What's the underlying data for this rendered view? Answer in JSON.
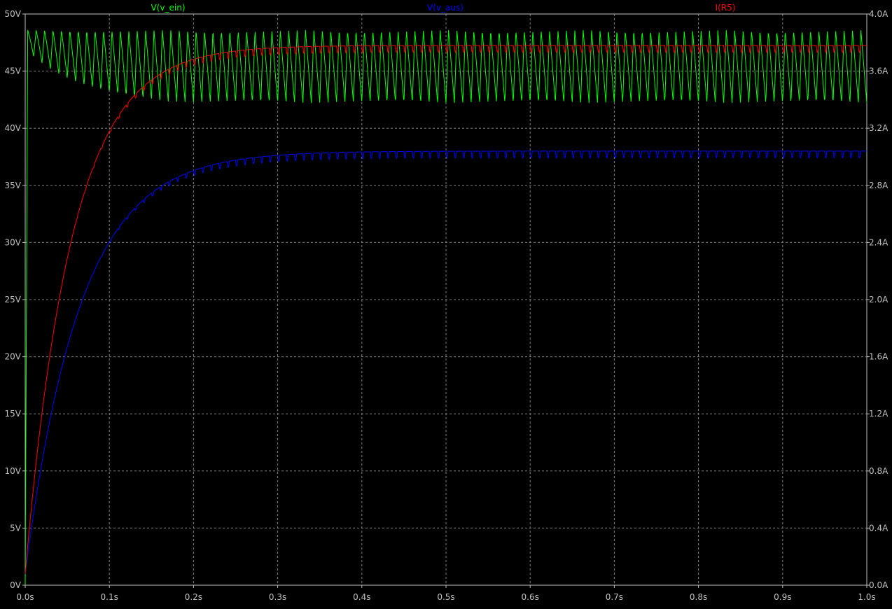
{
  "chart_data": {
    "type": "line",
    "xlabel": "",
    "ylabel_left": "",
    "ylabel_right": "",
    "xlim": [
      0,
      1.0
    ],
    "ylim_left": [
      0,
      50
    ],
    "ylim_right": [
      0,
      4.0
    ],
    "grid": true,
    "legend_placement": "top",
    "x_ticks": [
      "0.0s",
      "0.1s",
      "0.2s",
      "0.3s",
      "0.4s",
      "0.5s",
      "0.6s",
      "0.7s",
      "0.8s",
      "0.9s",
      "1.0s"
    ],
    "y_ticks_left": [
      "0V",
      "5V",
      "10V",
      "15V",
      "20V",
      "25V",
      "30V",
      "35V",
      "40V",
      "45V",
      "50V"
    ],
    "y_ticks_right": [
      "0.0A",
      "0.4A",
      "0.8A",
      "1.2A",
      "1.6A",
      "2.0A",
      "2.4A",
      "2.8A",
      "3.2A",
      "3.6A",
      "4.0A"
    ],
    "series": [
      {
        "name": "V(v_ein)",
        "color": "#00ff00",
        "axis": "left",
        "description_values": {
          "startup_rise_time_s": 0.003,
          "ripple_period_s": 0.01,
          "ripple_peak": 48.6,
          "ripple_trough_initial": 47.0,
          "ripple_trough_steady": 42.2,
          "settle_time_s": 0.2
        }
      },
      {
        "name": "V(v_aus)",
        "color": "#0000ff",
        "axis": "left",
        "description_values": {
          "start": 1.0,
          "final": 38.0,
          "time_constant_s": 0.065,
          "ripple_period_s": 0.01,
          "ripple_depth": 0.6
        }
      },
      {
        "name": "I(R5)",
        "color": "#ff0000",
        "axis": "right",
        "description_values": {
          "start": 0.08,
          "final": 3.78,
          "time_constant_s": 0.055,
          "ripple_period_s": 0.01,
          "ripple_depth": 0.05
        }
      }
    ]
  }
}
